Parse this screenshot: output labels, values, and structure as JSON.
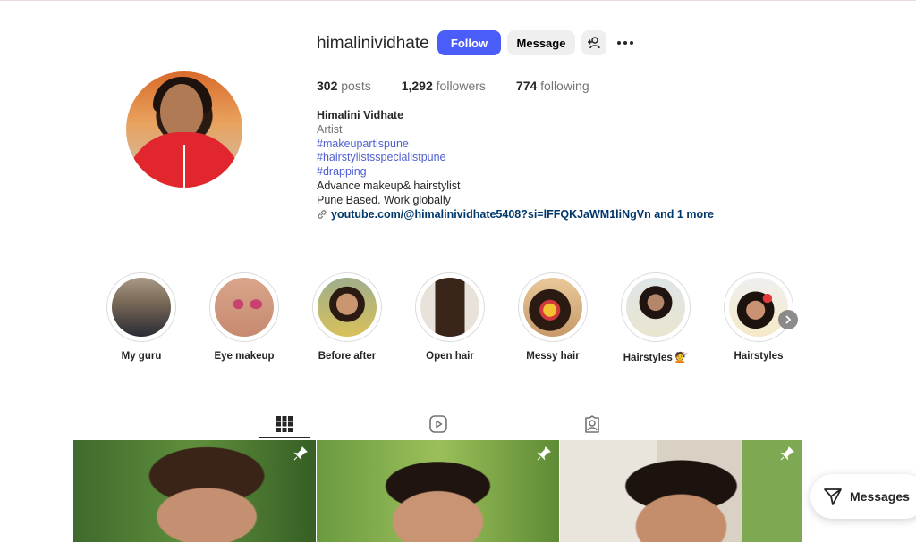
{
  "profile": {
    "username": "himalinividhate",
    "follow_label": "Follow",
    "message_label": "Message",
    "stats": {
      "posts_count": "302",
      "posts_label": "posts",
      "followers_count": "1,292",
      "followers_label": "followers",
      "following_count": "774",
      "following_label": "following"
    },
    "bio": {
      "name": "Himalini Vidhate",
      "category": "Artist",
      "tags": [
        "#makeupartispune",
        "#hairstylistsspecialistpune",
        "#drapping"
      ],
      "lines": [
        "Advance makeup& hairstylist",
        "Pune Based. Work globally"
      ],
      "link_text": "youtube.com/@himalinividhate5408?si=lFFQKJaWM1liNgVn and 1 more"
    }
  },
  "highlights": [
    {
      "label": "My guru"
    },
    {
      "label": "Eye makeup"
    },
    {
      "label": "Before after"
    },
    {
      "label": "Open hair"
    },
    {
      "label": "Messy hair"
    },
    {
      "label": "Hairstyles 💇"
    },
    {
      "label": "Hairstyles"
    }
  ],
  "tabs": [
    {
      "icon": "grid-icon",
      "active": true
    },
    {
      "icon": "reels-icon",
      "active": false
    },
    {
      "icon": "tagged-icon",
      "active": false
    }
  ],
  "messages_label": "Messages",
  "colors": {
    "accent": "#4a5df9",
    "link": "#00376b",
    "hashtag": "#4f5fd0"
  }
}
